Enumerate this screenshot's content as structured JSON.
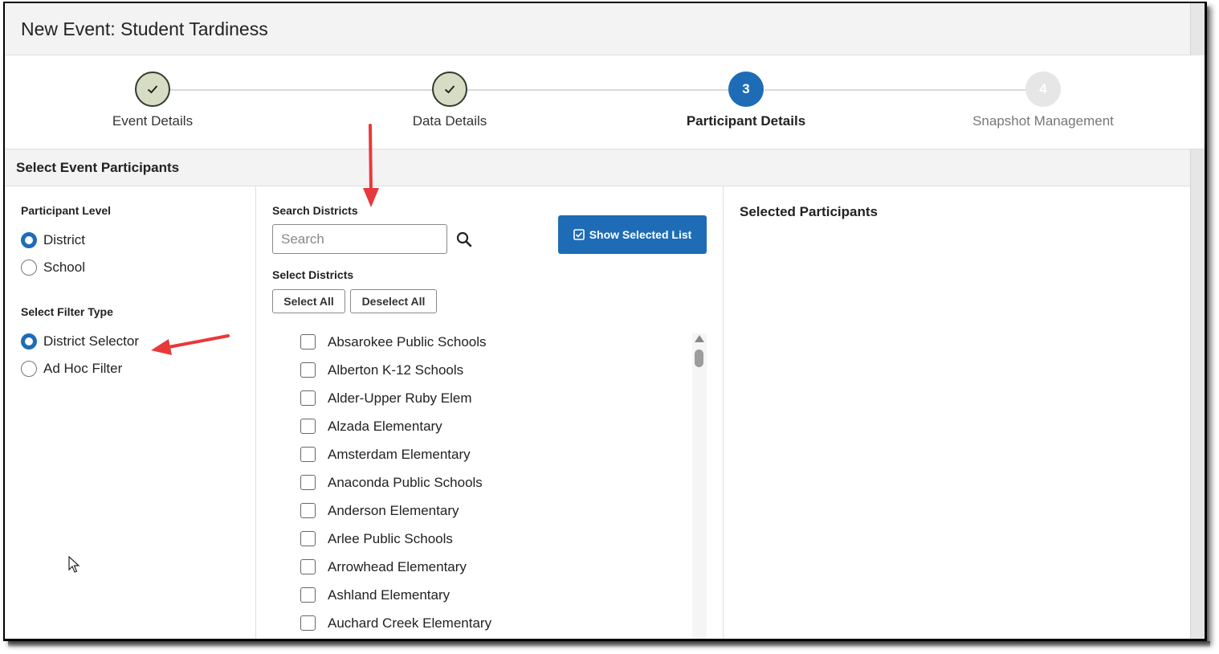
{
  "header": {
    "title": "New Event: Student Tardiness"
  },
  "stepper": {
    "steps": [
      {
        "label": "Event Details",
        "state": "done"
      },
      {
        "label": "Data Details",
        "state": "done"
      },
      {
        "label": "Participant Details",
        "state": "active",
        "number": "3"
      },
      {
        "label": "Snapshot Management",
        "state": "pending",
        "number": "4"
      }
    ]
  },
  "section": {
    "title": "Select Event Participants"
  },
  "participant_level": {
    "title": "Participant Level",
    "options": [
      "District",
      "School"
    ],
    "selected": "District"
  },
  "filter_type": {
    "title": "Select Filter Type",
    "options": [
      "District Selector",
      "Ad Hoc Filter"
    ],
    "selected": "District Selector"
  },
  "search": {
    "title": "Search Districts",
    "placeholder": "Search"
  },
  "select_districts": {
    "title": "Select Districts",
    "select_all": "Select All",
    "deselect_all": "Deselect All",
    "items": [
      "Absarokee Public Schools",
      "Alberton K-12 Schools",
      "Alder-Upper Ruby Elem",
      "Alzada Elementary",
      "Amsterdam Elementary",
      "Anaconda Public Schools",
      "Anderson Elementary",
      "Arlee Public Schools",
      "Arrowhead Elementary",
      "Ashland Elementary",
      "Auchard Creek Elementary"
    ]
  },
  "show_selected_list": {
    "label": "Show Selected List"
  },
  "selected_participants": {
    "title": "Selected Participants"
  },
  "colors": {
    "accent": "#1e6cb5",
    "done_step": "#d7ddc4",
    "annotation_arrow": "#e8393a"
  }
}
